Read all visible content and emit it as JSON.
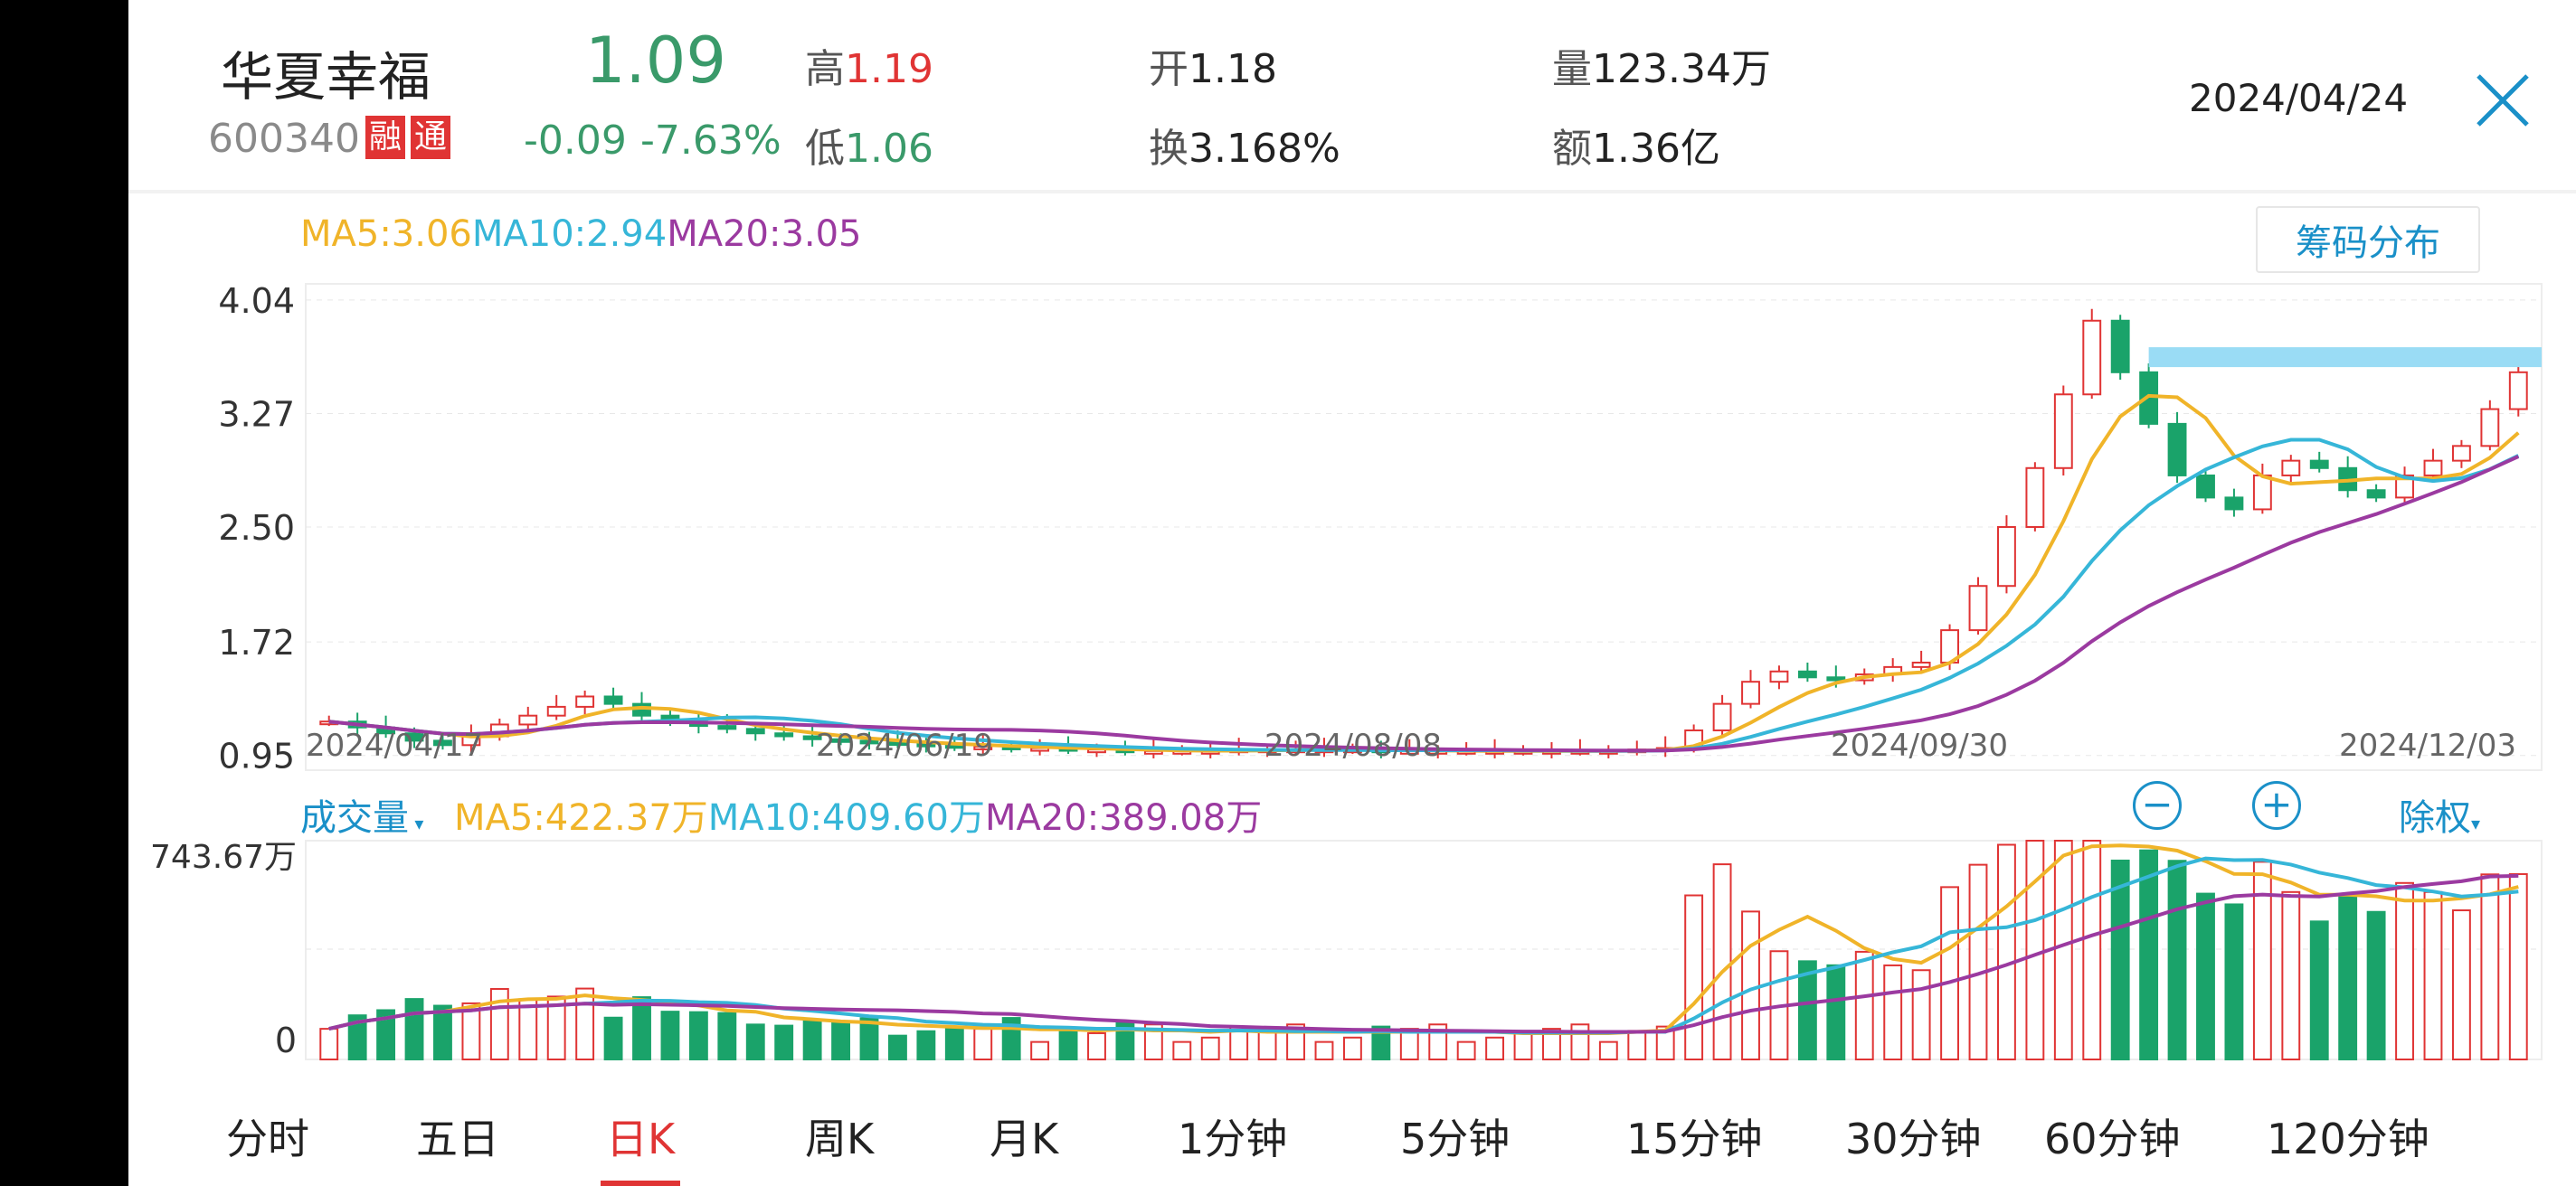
{
  "header": {
    "stock_name": "华夏幸福",
    "stock_code": "600340",
    "tag_margin": "融",
    "tag_connect": "通",
    "price": "1.09",
    "change": "-0.09",
    "change_pct": "-7.63%",
    "high_label": "高",
    "high_value": "1.19",
    "low_label": "低",
    "low_value": "1.06",
    "open_label": "开",
    "open_value": "1.18",
    "turnover_label": "换",
    "turnover_value": "3.168%",
    "volume_label": "量",
    "volume_value": "123.34万",
    "amount_label": "额",
    "amount_value": "1.36亿",
    "date": "2024/04/24",
    "close_icon": "close-icon"
  },
  "price_chart": {
    "ma5": "MA5:3.06",
    "ma10": "MA10:2.94",
    "ma20": "MA20:3.05",
    "chip_button": "筹码分布",
    "y_ticks": [
      "4.04",
      "3.27",
      "2.50",
      "1.72",
      "0.95"
    ],
    "x_ticks": [
      "2024/04/17",
      "2024/06/19",
      "2024/08/08",
      "2024/09/30",
      "2024/12/03"
    ]
  },
  "volume_chart": {
    "label": "成交量",
    "ma5": "MA5:422.37万",
    "ma10": "MA10:409.60万",
    "ma20": "MA20:389.08万",
    "max_label": "743.67万",
    "zero_label": "0",
    "minus": "−",
    "plus": "+",
    "adjust": "除权"
  },
  "tabs": [
    "分时",
    "五日",
    "日K",
    "周K",
    "月K",
    "1分钟",
    "5分钟",
    "15分钟",
    "30分钟",
    "60分钟",
    "120分钟"
  ],
  "active_tab": "日K",
  "colors": {
    "up": "#e03434",
    "down": "#1aa36a",
    "ma5": "#f0b429",
    "ma10": "#36b6d8",
    "ma20": "#9b3aa0",
    "accent": "#1a90c8"
  },
  "chart_data": {
    "type": "candlestick",
    "y_range": [
      0.95,
      4.04
    ],
    "x_range_dates": [
      "2024/04/17",
      "2024/12/03"
    ],
    "close_series": [
      1.18,
      1.14,
      1.1,
      1.05,
      1.02,
      1.08,
      1.16,
      1.22,
      1.28,
      1.35,
      1.3,
      1.22,
      1.18,
      1.15,
      1.13,
      1.1,
      1.08,
      1.06,
      1.05,
      1.04,
      1.03,
      1.02,
      1.01,
      1.01,
      1.0,
      1.0,
      0.99,
      0.99,
      0.98,
      0.98,
      0.98,
      0.98,
      0.99,
      0.99,
      0.99,
      0.99,
      0.99,
      0.98,
      0.98,
      0.98,
      0.98,
      0.98,
      0.98,
      0.98,
      0.98,
      0.98,
      0.99,
      1.0,
      1.12,
      1.3,
      1.45,
      1.52,
      1.48,
      1.46,
      1.5,
      1.55,
      1.58,
      1.8,
      2.1,
      2.5,
      2.9,
      3.4,
      3.9,
      3.55,
      3.2,
      2.85,
      2.7,
      2.62,
      2.85,
      2.95,
      2.9,
      2.75,
      2.7,
      2.85,
      2.95,
      3.05,
      3.3,
      3.55
    ]
  }
}
